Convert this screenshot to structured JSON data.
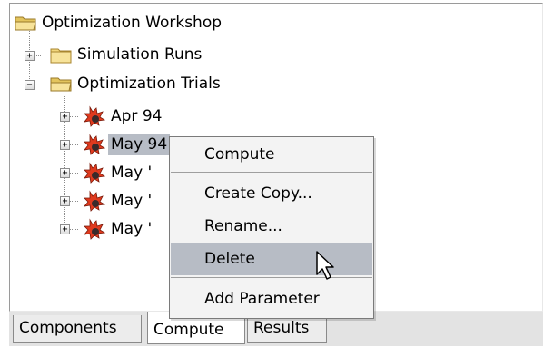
{
  "tree": {
    "root": {
      "label": "Optimization Workshop",
      "icon": "open-folder-icon"
    },
    "nodes": [
      {
        "label": "Simulation Runs",
        "icon": "folder-icon",
        "expander": "+"
      },
      {
        "label": "Optimization Trials",
        "icon": "open-folder-icon",
        "expander": "−"
      }
    ],
    "trials": [
      {
        "label": "Apr 94",
        "icon": "trial-icon",
        "expander": "+",
        "selected": false
      },
      {
        "label": "May 94",
        "icon": "trial-icon",
        "expander": "+",
        "selected": true
      },
      {
        "label": "May '",
        "icon": "trial-icon",
        "expander": "+",
        "selected": false
      },
      {
        "label": "May '",
        "icon": "trial-icon",
        "expander": "+",
        "selected": false
      },
      {
        "label": "May '",
        "icon": "trial-icon",
        "expander": "+",
        "selected": false
      }
    ]
  },
  "context_menu": {
    "items": [
      {
        "label": "Compute"
      },
      {
        "label": "Create Copy..."
      },
      {
        "label": "Rename..."
      },
      {
        "label": "Delete",
        "highlighted": true
      },
      {
        "label": "Add Parameter"
      }
    ]
  },
  "tabs": [
    {
      "label": "Components",
      "active": false
    },
    {
      "label": "Compute",
      "active": true
    },
    {
      "label": "Results",
      "active": false
    }
  ],
  "colors": {
    "selection": "#b7bcc5",
    "menu_background": "#f3f3f3",
    "folder": "#f2d77c"
  }
}
